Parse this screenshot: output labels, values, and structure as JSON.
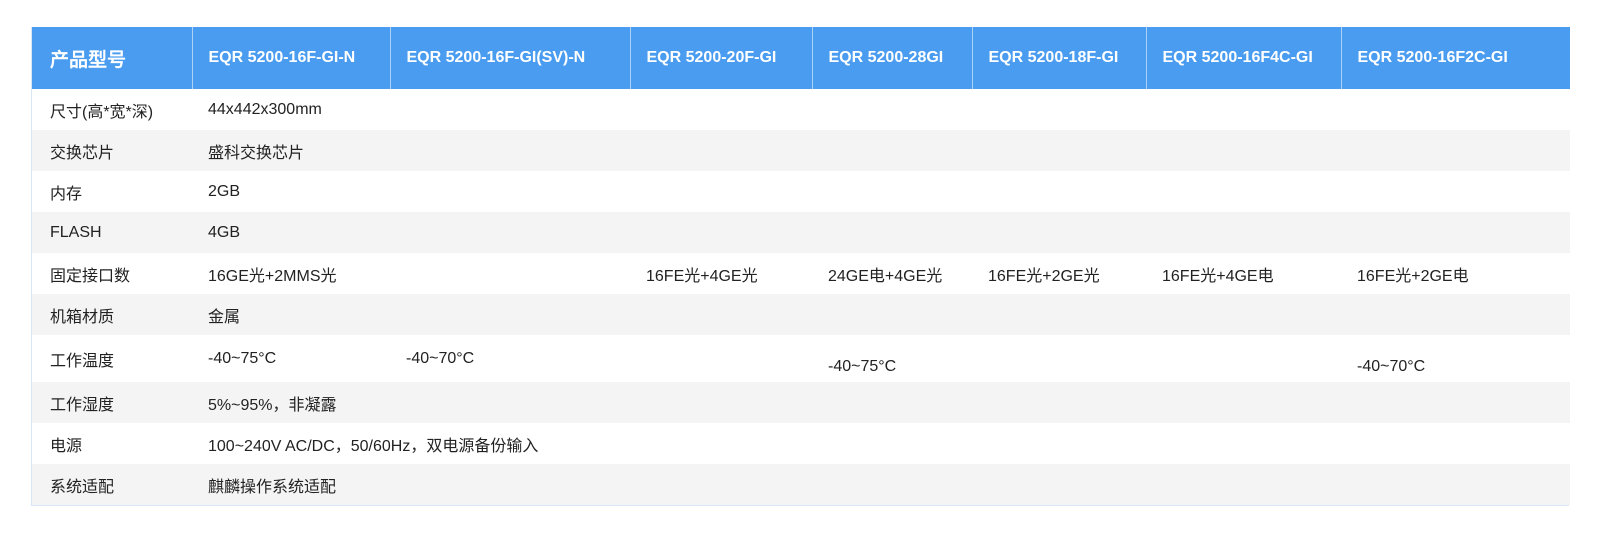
{
  "table": {
    "header": {
      "corner": "产品型号",
      "models": [
        "EQR 5200-16F-GI-N",
        "EQR 5200-16F-GI(SV)-N",
        "EQR 5200-20F-GI",
        "EQR 5200-28GI",
        "EQR 5200-18F-GI",
        "EQR 5200-16F4C-GI",
        "EQR 5200-16F2C-GI"
      ]
    },
    "rows": {
      "size": {
        "label": "尺寸(高*宽*深)",
        "value": "44x442x300mm"
      },
      "chip": {
        "label": "交换芯片",
        "value": "盛科交换芯片"
      },
      "memory": {
        "label": "内存",
        "value": "2GB"
      },
      "flash": {
        "label": "FLASH",
        "value": "4GB"
      },
      "ports": {
        "label": "固定接口数",
        "values": [
          "16GE光+2MMS光",
          "16FE光+4GE光",
          "24GE电+4GE光",
          "16FE光+2GE光",
          "16FE光+4GE电",
          "16FE光+2GE电"
        ]
      },
      "chassis": {
        "label": "机箱材质",
        "value": "金属"
      },
      "temperature": {
        "label": "工作温度",
        "values": [
          "-40~75°C",
          "-40~70°C",
          "-40~75°C",
          "-40~70°C"
        ]
      },
      "humidity": {
        "label": "工作湿度",
        "value": "5%~95%，非凝露"
      },
      "power": {
        "label": "电源",
        "value": "100~240V AC/DC，50/60Hz，双电源备份输入"
      },
      "os": {
        "label": "系统适配",
        "value": "麒麟操作系统适配"
      }
    }
  },
  "colors": {
    "header_bg": "#4a9cf0",
    "header_text": "#ffffff",
    "stripe_bg": "#f4f4f4",
    "body_text": "#222222"
  }
}
